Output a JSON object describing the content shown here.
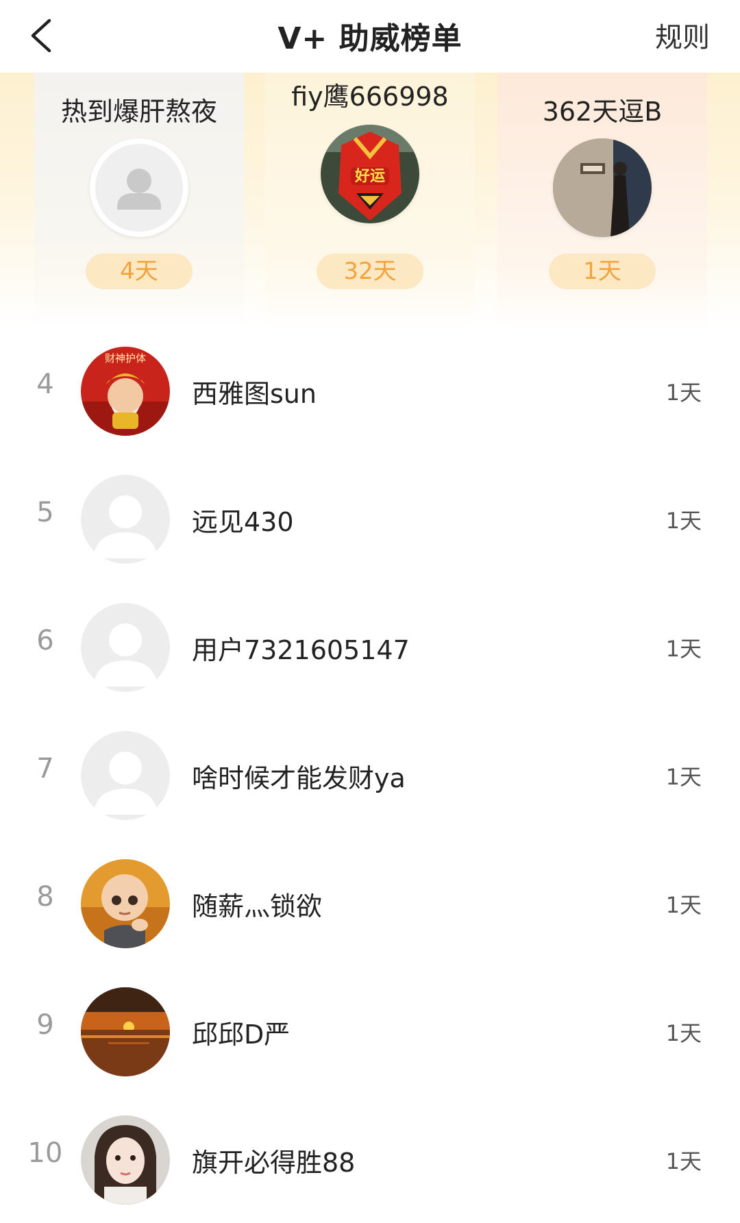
{
  "header": {
    "title": "V+ 助威榜单",
    "rules_label": "规则"
  },
  "podium": [
    {
      "name": "热到爆肝熬夜",
      "days": "4天",
      "avatar": "default-avatar"
    },
    {
      "name": "fiy鹰666998",
      "days": "32天",
      "avatar": "red-mecha-avatar"
    },
    {
      "name": "362天逗B",
      "days": "1天",
      "avatar": "person-photo-avatar"
    }
  ],
  "ranking": [
    {
      "rank": "4",
      "name": "西雅图sun",
      "days": "1天",
      "avatar": "god-of-wealth-avatar"
    },
    {
      "rank": "5",
      "name": "远见430",
      "days": "1天",
      "avatar": "default-avatar"
    },
    {
      "rank": "6",
      "name": "用户7321605147",
      "days": "1天",
      "avatar": "default-avatar"
    },
    {
      "rank": "7",
      "name": "啥时候才能发财ya",
      "days": "1天",
      "avatar": "default-avatar"
    },
    {
      "rank": "8",
      "name": "随薪灬锁欲",
      "days": "1天",
      "avatar": "cartoon-monk-avatar"
    },
    {
      "rank": "9",
      "name": "邱邱D严",
      "days": "1天",
      "avatar": "sunset-avatar"
    },
    {
      "rank": "10",
      "name": "旗开必得胜88",
      "days": "1天",
      "avatar": "girl-photo-avatar"
    }
  ],
  "colors": {
    "days_pill_bg": "#fde8c4",
    "days_pill_text": "#f3a33c",
    "podium_bg": "#fdf0cf"
  }
}
